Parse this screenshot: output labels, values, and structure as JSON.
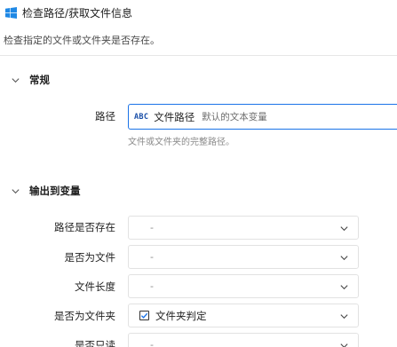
{
  "header": {
    "title": "检查路径/获取文件信息",
    "description": "检查指定的文件或文件夹是否存在。"
  },
  "general": {
    "section_label": "常规",
    "path_label": "路径",
    "path_type_icon": "ABC",
    "path_value": "文件路径",
    "path_placeholder": "默认的文本变量",
    "path_hint": "文件或文件夹的完整路径。"
  },
  "output": {
    "section_label": "输出到变量",
    "fields": [
      {
        "label": "路径是否存在",
        "value": "-"
      },
      {
        "label": "是否为文件",
        "value": "-"
      },
      {
        "label": "文件长度",
        "value": "-"
      },
      {
        "label": "是否为文件夹",
        "value": "文件夹判定",
        "checked": true
      },
      {
        "label": "是否只读",
        "value": "-"
      }
    ]
  },
  "colors": {
    "accent": "#1a73e8",
    "window_icon": "#1e88e5"
  }
}
